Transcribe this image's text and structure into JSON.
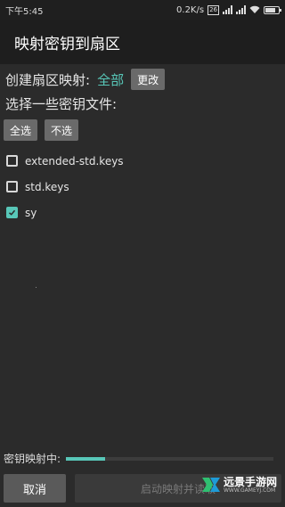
{
  "status_bar": {
    "time": "下午5:45",
    "net_speed": "0.2K/s",
    "badge": "26",
    "battery_level": 0.8
  },
  "title": "映射密钥到扇区",
  "create_sector_map": {
    "label": "创建扇区映射:",
    "value": "全部",
    "change_button": "更改"
  },
  "select_keys_label": "选择一些密钥文件:",
  "select_all_button": "全选",
  "select_none_button": "不选",
  "key_files": [
    {
      "name": "extended-std.keys",
      "checked": false
    },
    {
      "name": "std.keys",
      "checked": false
    },
    {
      "name": "sy",
      "checked": true
    }
  ],
  "progress": {
    "label": "密钥映射中:",
    "value": 0.19
  },
  "cancel_button": "取消",
  "start_button": "启动映射并读取",
  "watermark": {
    "name_cn": "远景手游网",
    "site": "WWW.GAMEYJ.COM"
  },
  "colors": {
    "accent": "#58c7b8",
    "background": "#2b2b2b",
    "titlebar": "#1e1e1e"
  }
}
